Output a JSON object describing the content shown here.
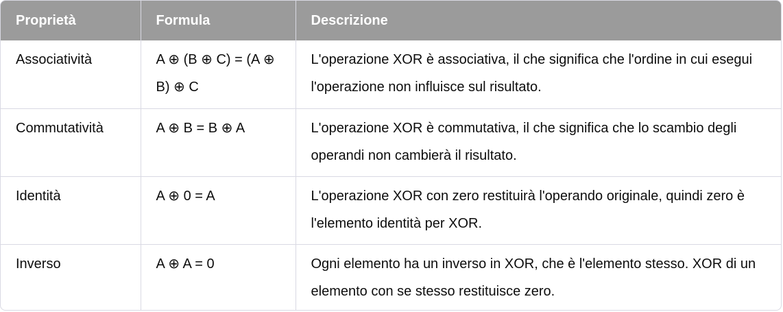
{
  "table": {
    "headers": [
      "Proprietà",
      "Formula",
      "Descrizione"
    ],
    "rows": [
      {
        "property": "Associatività",
        "formula": "A ⊕ (B ⊕ C) = (A ⊕ B) ⊕ C",
        "description": "L'operazione XOR è associativa, il che significa che l'ordine in cui esegui l'operazione non influisce sul risultato."
      },
      {
        "property": "Commutatività",
        "formula": "A ⊕ B = B ⊕ A",
        "description": "L'operazione XOR è commutativa, il che significa che lo scambio degli operandi non cambierà il risultato."
      },
      {
        "property": "Identità",
        "formula": "A ⊕ 0 = A",
        "description": "L'operazione XOR con zero restituirà l'operando originale, quindi zero è l'elemento identità per XOR."
      },
      {
        "property": "Inverso",
        "formula": "A ⊕ A = 0",
        "description": "Ogni elemento ha un inverso in XOR, che è l'elemento stesso. XOR di un elemento con se stesso restituisce zero."
      }
    ]
  }
}
